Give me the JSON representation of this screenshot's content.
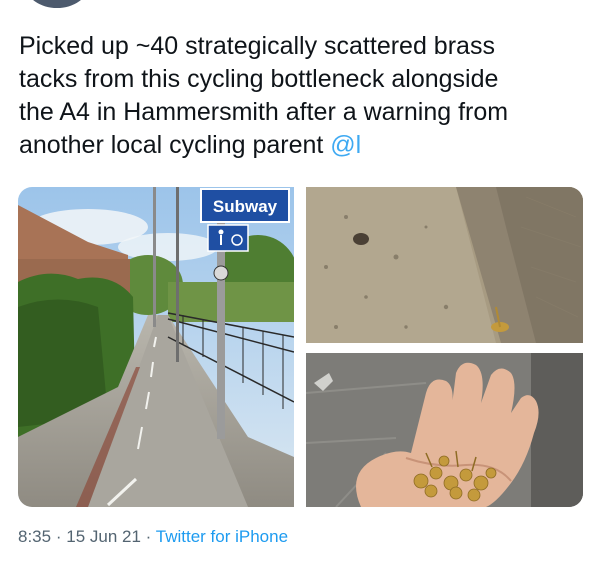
{
  "tweet": {
    "text_lines": [
      "Picked up ~40 strategically scattered brass",
      "tacks from this cycling bottleneck alongside",
      "the A4 in Hammersmith after a warning from",
      "another local cycling parent "
    ],
    "mention": "@l"
  },
  "photos": {
    "street": {
      "sign_label": "Subway"
    },
    "concrete": {},
    "hand": {}
  },
  "footer": {
    "time": "8:35",
    "separator": "·",
    "date": "15 Jun 21",
    "source": "Twitter for iPhone"
  },
  "colors": {
    "link": "#1d9bf0",
    "meta_text": "#536471",
    "sign_blue": "#1f4fa3",
    "brass": "#c49a3c"
  }
}
